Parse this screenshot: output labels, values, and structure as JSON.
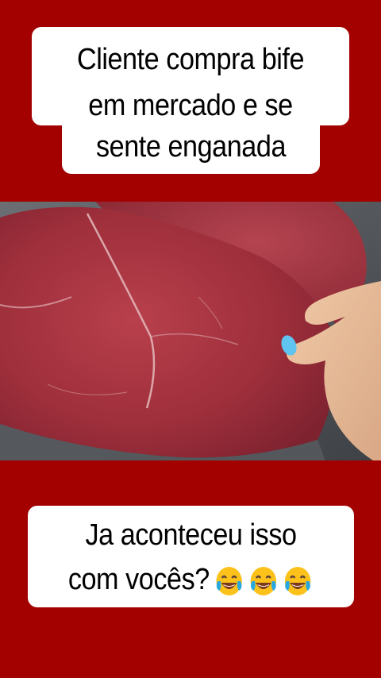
{
  "background_color": "#a30000",
  "top_caption": {
    "line1": "Cliente compra bife",
    "line2": "em mercado e se",
    "line3": "sente enganada"
  },
  "bottom_caption": {
    "line1": "Ja aconteceu isso",
    "line2": "com vocês?"
  },
  "emojis": [
    "face-with-tears-of-joy-icon",
    "face-with-tears-of-joy-icon",
    "face-with-tears-of-joy-icon"
  ],
  "photo_subject": "raw beef steak with hand"
}
